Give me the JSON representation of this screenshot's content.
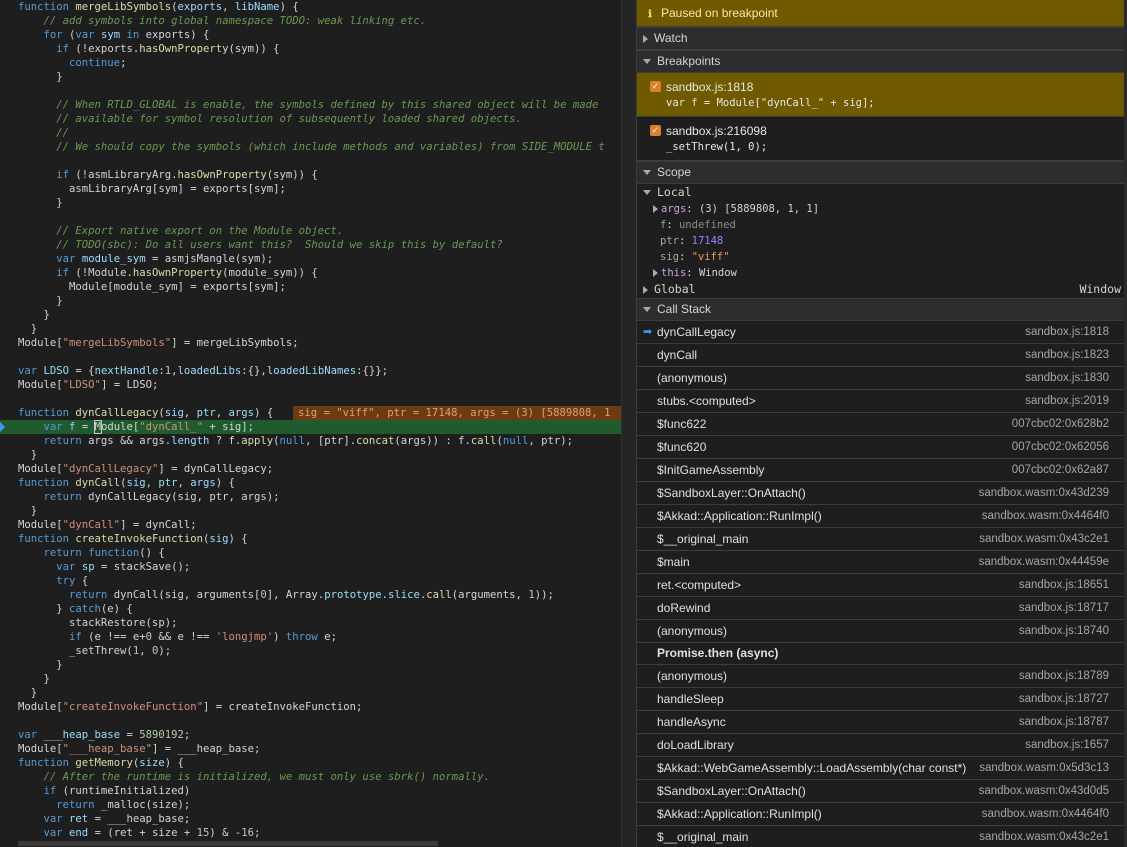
{
  "code": {
    "inline_value": "sig = \"viff\", ptr = 17148, args = (3) [5889808, 1"
  },
  "debugger": {
    "paused_banner": "Paused on breakpoint",
    "sections": {
      "watch": "Watch",
      "breakpoints": "Breakpoints",
      "scope": "Scope",
      "call_stack": "Call Stack"
    },
    "breakpoints": [
      {
        "location": "sandbox.js:1818",
        "code": "var f = Module[\"dynCall_\" + sig];",
        "checked": true,
        "active": true
      },
      {
        "location": "sandbox.js:216098",
        "code": "_setThrew(1, 0);",
        "checked": true,
        "active": false
      }
    ],
    "scope": {
      "local_label": "Local",
      "vars": [
        {
          "name": "args",
          "value": "(3) [5889808, 1, 1]",
          "expandable": true,
          "kind": "plain"
        },
        {
          "name": "f",
          "value": "undefined",
          "expandable": false,
          "kind": "undefined"
        },
        {
          "name": "ptr",
          "value": "17148",
          "expandable": false,
          "kind": "number"
        },
        {
          "name": "sig",
          "value": "\"viff\"",
          "expandable": false,
          "kind": "string"
        },
        {
          "name": "this",
          "value": "Window",
          "expandable": true,
          "kind": "plain"
        }
      ],
      "global_label": "Global",
      "global_value": "Window"
    },
    "call_stack": [
      {
        "name": "dynCallLegacy",
        "location": "sandbox.js:1818",
        "current": true
      },
      {
        "name": "dynCall",
        "location": "sandbox.js:1823"
      },
      {
        "name": "(anonymous)",
        "location": "sandbox.js:1830"
      },
      {
        "name": "stubs.<computed>",
        "location": "sandbox.js:2019"
      },
      {
        "name": "$func622",
        "location": "007cbc02:0x628b2"
      },
      {
        "name": "$func620",
        "location": "007cbc02:0x62056"
      },
      {
        "name": "$InitGameAssembly",
        "location": "007cbc02:0x62a87"
      },
      {
        "name": "$SandboxLayer::OnAttach()",
        "location": "sandbox.wasm:0x43d239"
      },
      {
        "name": "$Akkad::Application::RunImpl()",
        "location": "sandbox.wasm:0x4464f0"
      },
      {
        "name": "$__original_main",
        "location": "sandbox.wasm:0x43c2e1"
      },
      {
        "name": "$main",
        "location": "sandbox.wasm:0x44459e"
      },
      {
        "name": "ret.<computed>",
        "location": "sandbox.js:18651"
      },
      {
        "name": "doRewind",
        "location": "sandbox.js:18717"
      },
      {
        "name": "(anonymous)",
        "location": "sandbox.js:18740"
      },
      {
        "async_label": "Promise.then (async)"
      },
      {
        "name": "(anonymous)",
        "location": "sandbox.js:18789"
      },
      {
        "name": "handleSleep",
        "location": "sandbox.js:18727"
      },
      {
        "name": "handleAsync",
        "location": "sandbox.js:18787"
      },
      {
        "name": "doLoadLibrary",
        "location": "sandbox.js:1657"
      },
      {
        "name": "$Akkad::WebGameAssembly::LoadAssembly(char const*)",
        "location": "sandbox.wasm:0x5d3c13"
      },
      {
        "name": "$SandboxLayer::OnAttach()",
        "location": "sandbox.wasm:0x43d0d5"
      },
      {
        "name": "$Akkad::Application::RunImpl()",
        "location": "sandbox.wasm:0x4464f0"
      },
      {
        "name": "$__original_main",
        "location": "sandbox.wasm:0x43c2e1"
      },
      {
        "name": "$main",
        "location": "sandbox.wasm:0x44459e"
      }
    ]
  }
}
